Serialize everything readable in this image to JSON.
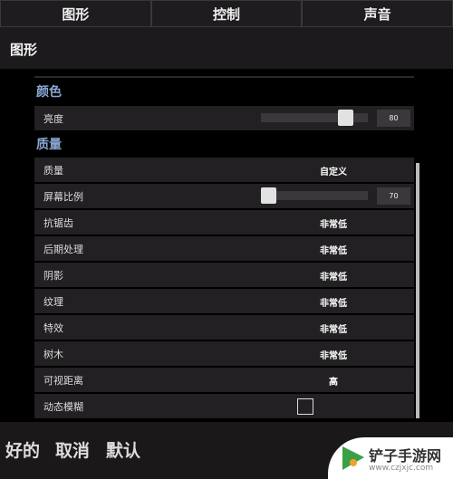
{
  "tabs": [
    "图形",
    "控制",
    "声音"
  ],
  "header": "图形",
  "sections": {
    "color": "颜色",
    "quality": "质量"
  },
  "brightness": {
    "label": "亮度",
    "value": "80",
    "fraction": 0.8
  },
  "rows": [
    {
      "label": "质量",
      "value": "自定义"
    },
    {
      "label": "屏幕比例",
      "value": "70",
      "fraction": 0.0
    },
    {
      "label": "抗锯齿",
      "value": "非常低"
    },
    {
      "label": "后期处理",
      "value": "非常低"
    },
    {
      "label": "阴影",
      "value": "非常低"
    },
    {
      "label": "纹理",
      "value": "非常低"
    },
    {
      "label": "特效",
      "value": "非常低"
    },
    {
      "label": "树木",
      "value": "非常低"
    },
    {
      "label": "可视距离",
      "value": "高"
    },
    {
      "label": "动态模糊",
      "checked": false
    }
  ],
  "footer": {
    "ok": "好的",
    "cancel": "取消",
    "default": "默认"
  },
  "watermark": {
    "text": "铲子手游网",
    "url": "www.czjxjc.com"
  }
}
